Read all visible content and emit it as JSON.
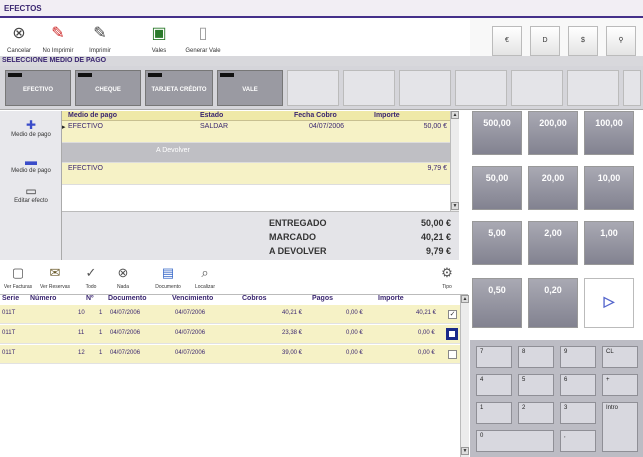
{
  "window": {
    "title": "EFECTOS"
  },
  "toolbar": {
    "items": [
      {
        "label": "Cancelar",
        "icon": "cancel-icon"
      },
      {
        "label": "No Imprimir",
        "icon": "no-print-icon"
      },
      {
        "label": "Imprimir",
        "icon": "print-icon"
      },
      {
        "label": "Vales",
        "icon": "vouchers-icon"
      },
      {
        "label": "Generar Vale",
        "icon": "generate-voucher-icon"
      }
    ]
  },
  "currency": {
    "buttons": [
      "€",
      "D",
      "$"
    ],
    "search_icon": "search-icon"
  },
  "payment": {
    "header": "SELECCIONE MEDIO DE PAGO",
    "methods": [
      "EFECTIVO",
      "CHEQUE",
      "TARJETA CRÉDITO",
      "VALE"
    ]
  },
  "side": {
    "items": [
      {
        "label": "Medio de pago",
        "icon": "add-icon"
      },
      {
        "label": "Medio de pago",
        "icon": "remove-icon"
      },
      {
        "label": "Editar efecto",
        "icon": "edit-icon"
      }
    ]
  },
  "payment_grid": {
    "columns": [
      "Medio de pago",
      "Estado",
      "Fecha Cobro",
      "Importe"
    ],
    "rows": [
      {
        "medio": "EFECTIVO",
        "estado": "SALDAR",
        "fecha": "04/07/2006",
        "importe": "50,00 €"
      },
      {
        "medio": "",
        "estado": "",
        "fecha": "",
        "importe": ""
      },
      {
        "medio": "EFECTIVO",
        "estado": "",
        "fecha": "",
        "importe": "9,79 €"
      }
    ],
    "devolver_label": "A Devolver"
  },
  "totals": {
    "entregado_label": "ENTREGADO",
    "entregado": "50,00 €",
    "marcado_label": "MARCADO",
    "marcado": "40,21 €",
    "devolver_label": "A DEVOLVER",
    "devolver": "9,79 €"
  },
  "amounts": [
    "500,00",
    "200,00",
    "100,00",
    "50,00",
    "20,00",
    "10,00",
    "5,00",
    "2,00",
    "1,00",
    "0,50",
    "0,20"
  ],
  "toolbar2": {
    "items": [
      {
        "label": "Ver Facturas",
        "icon": "invoices-icon"
      },
      {
        "label": "Ver Reservas",
        "icon": "reservations-icon"
      },
      {
        "label": "Todo",
        "icon": "select-all-icon"
      },
      {
        "label": "Nada",
        "icon": "select-none-icon"
      },
      {
        "label": "Documento",
        "icon": "document-icon"
      },
      {
        "label": "Localizar",
        "icon": "locate-icon"
      },
      {
        "label": "Tipo",
        "icon": "type-icon"
      }
    ]
  },
  "invoices": {
    "columns": [
      "Serie",
      "Número",
      "Nº",
      "Documento",
      "Vencimiento",
      "Cobros",
      "Pagos",
      "Importe"
    ],
    "rows": [
      {
        "serie": "011T",
        "numero": "10",
        "n": "1",
        "documento": "04/07/2006",
        "vencimiento": "04/07/2006",
        "cobros": "40,21 €",
        "pagos": "0,00 €",
        "importe": "40,21 €",
        "checked": true
      },
      {
        "serie": "011T",
        "numero": "11",
        "n": "1",
        "documento": "04/07/2006",
        "vencimiento": "04/07/2006",
        "cobros": "23,38 €",
        "pagos": "0,00 €",
        "importe": "0,00 €",
        "checked": false
      },
      {
        "serie": "011T",
        "numero": "12",
        "n": "1",
        "documento": "04/07/2006",
        "vencimiento": "04/07/2006",
        "cobros": "39,00 €",
        "pagos": "0,00 €",
        "importe": "0,00 €",
        "checked": false
      }
    ]
  },
  "keypad": {
    "keys": [
      "7",
      "8",
      "9",
      "CL",
      "4",
      "5",
      "6",
      "+",
      "1",
      "2",
      "3",
      "Intro",
      "0",
      ","
    ]
  }
}
